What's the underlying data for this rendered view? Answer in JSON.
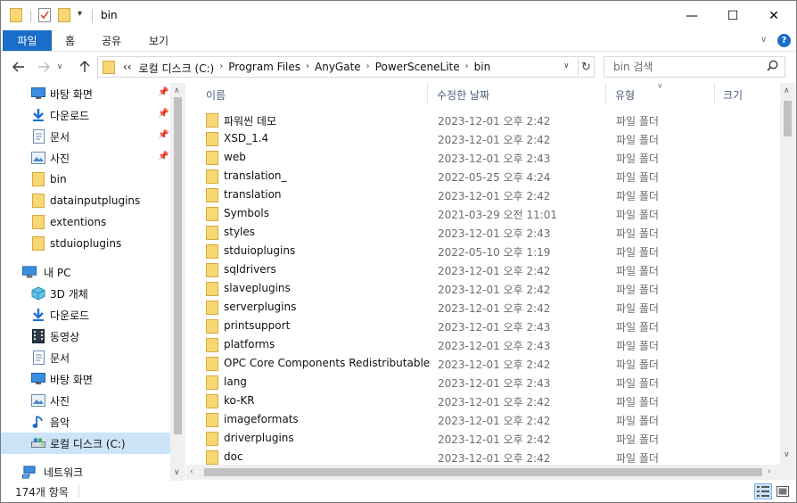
{
  "window": {
    "title": "bin",
    "controls": {
      "minimize": "—",
      "maximize": "☐",
      "close": "✕"
    }
  },
  "ribbon": {
    "tabs": [
      {
        "label": "파일"
      },
      {
        "label": "홈"
      },
      {
        "label": "공유"
      },
      {
        "label": "보기"
      }
    ],
    "help": "?"
  },
  "address": {
    "overflow": "‹‹",
    "crumbs": [
      "로컬 디스크 (C:)",
      "Program Files",
      "AnyGate",
      "PowerSceneLite",
      "bin"
    ],
    "separator": "›"
  },
  "search": {
    "placeholder": "bin 검색"
  },
  "nav": {
    "quick_access": [
      {
        "label": "바탕 화면",
        "icon": "desktop-icon",
        "pinned": true
      },
      {
        "label": "다운로드",
        "icon": "download-icon",
        "pinned": true
      },
      {
        "label": "문서",
        "icon": "document-icon",
        "pinned": true
      },
      {
        "label": "사진",
        "icon": "pictures-icon",
        "pinned": true
      },
      {
        "label": "bin",
        "icon": "folder-icon",
        "pinned": false
      },
      {
        "label": "datainputplugins",
        "icon": "folder-icon",
        "pinned": false
      },
      {
        "label": "extentions",
        "icon": "folder-icon",
        "pinned": false
      },
      {
        "label": "stduioplugins",
        "icon": "folder-icon",
        "pinned": false
      }
    ],
    "this_pc": {
      "label": "내 PC",
      "items": [
        {
          "label": "3D 개체",
          "icon": "3d-objects-icon"
        },
        {
          "label": "다운로드",
          "icon": "download-icon"
        },
        {
          "label": "동영상",
          "icon": "video-icon"
        },
        {
          "label": "문서",
          "icon": "document-icon"
        },
        {
          "label": "바탕 화면",
          "icon": "desktop-icon"
        },
        {
          "label": "사진",
          "icon": "pictures-icon"
        },
        {
          "label": "음악",
          "icon": "music-icon"
        },
        {
          "label": "로컬 디스크 (C:)",
          "icon": "drive-icon",
          "selected": true
        }
      ]
    },
    "network": {
      "label": "네트워크"
    }
  },
  "columns": {
    "name": "이름",
    "date": "수정한 날짜",
    "type": "유형",
    "size": "크기"
  },
  "files": [
    {
      "name": "파워씬 데모",
      "date": "2023-12-01 오후 2:42",
      "type": "파일 폴더"
    },
    {
      "name": "XSD_1.4",
      "date": "2023-12-01 오후 2:42",
      "type": "파일 폴더"
    },
    {
      "name": "web",
      "date": "2023-12-01 오후 2:43",
      "type": "파일 폴더"
    },
    {
      "name": "translation_",
      "date": "2022-05-25 오후 4:24",
      "type": "파일 폴더"
    },
    {
      "name": "translation",
      "date": "2023-12-01 오후 2:42",
      "type": "파일 폴더"
    },
    {
      "name": "Symbols",
      "date": "2021-03-29 오전 11:01",
      "type": "파일 폴더"
    },
    {
      "name": "styles",
      "date": "2023-12-01 오후 2:43",
      "type": "파일 폴더"
    },
    {
      "name": "stduioplugins",
      "date": "2022-05-10 오후 1:19",
      "type": "파일 폴더"
    },
    {
      "name": "sqldrivers",
      "date": "2023-12-01 오후 2:42",
      "type": "파일 폴더"
    },
    {
      "name": "slaveplugins",
      "date": "2023-12-01 오후 2:42",
      "type": "파일 폴더"
    },
    {
      "name": "serverplugins",
      "date": "2023-12-01 오후 2:42",
      "type": "파일 폴더"
    },
    {
      "name": "printsupport",
      "date": "2023-12-01 오후 2:43",
      "type": "파일 폴더"
    },
    {
      "name": "platforms",
      "date": "2023-12-01 오후 2:43",
      "type": "파일 폴더"
    },
    {
      "name": "OPC Core Components Redistributable (…",
      "date": "2023-12-01 오후 2:42",
      "type": "파일 폴더"
    },
    {
      "name": "lang",
      "date": "2023-12-01 오후 2:43",
      "type": "파일 폴더"
    },
    {
      "name": "ko-KR",
      "date": "2023-12-01 오후 2:42",
      "type": "파일 폴더"
    },
    {
      "name": "imageformats",
      "date": "2023-12-01 오후 2:42",
      "type": "파일 폴더"
    },
    {
      "name": "driverplugins",
      "date": "2023-12-01 오후 2:42",
      "type": "파일 폴더"
    },
    {
      "name": "doc",
      "date": "2023-12-01 오후 2:42",
      "type": "파일 폴더"
    }
  ],
  "status": {
    "item_count": "174개 항목"
  },
  "colors": {
    "accent": "#1a6dc8",
    "selection": "#cce4f7",
    "folder": "#f8d775",
    "folder_dark": "#e8b84a"
  }
}
